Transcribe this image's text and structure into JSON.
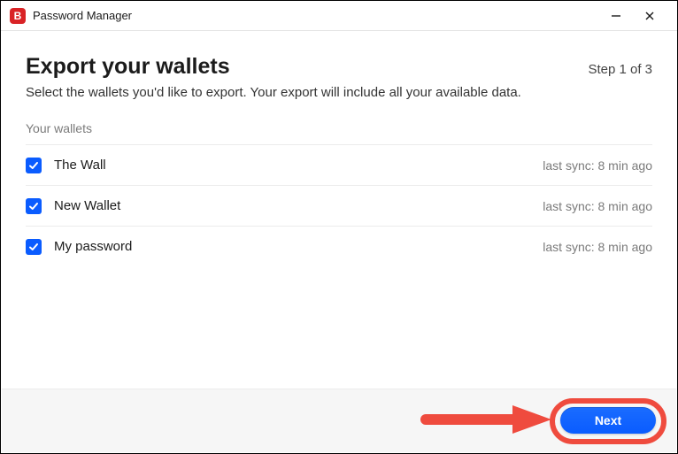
{
  "titlebar": {
    "app_icon_letter": "B",
    "title": "Password Manager"
  },
  "page": {
    "title": "Export your wallets",
    "subtitle": "Select the wallets you'd like to export. Your export will include all your available data.",
    "step_indicator": "Step 1 of 3",
    "section_label": "Your wallets"
  },
  "wallets": [
    {
      "name": "The Wall",
      "sync": "last sync: 8 min ago",
      "checked": true
    },
    {
      "name": "New Wallet",
      "sync": "last sync: 8 min ago",
      "checked": true
    },
    {
      "name": "My password",
      "sync": "last sync: 8 min ago",
      "checked": true
    }
  ],
  "footer": {
    "next_label": "Next"
  },
  "annotation": {
    "arrow_color": "#ef4b3e"
  }
}
